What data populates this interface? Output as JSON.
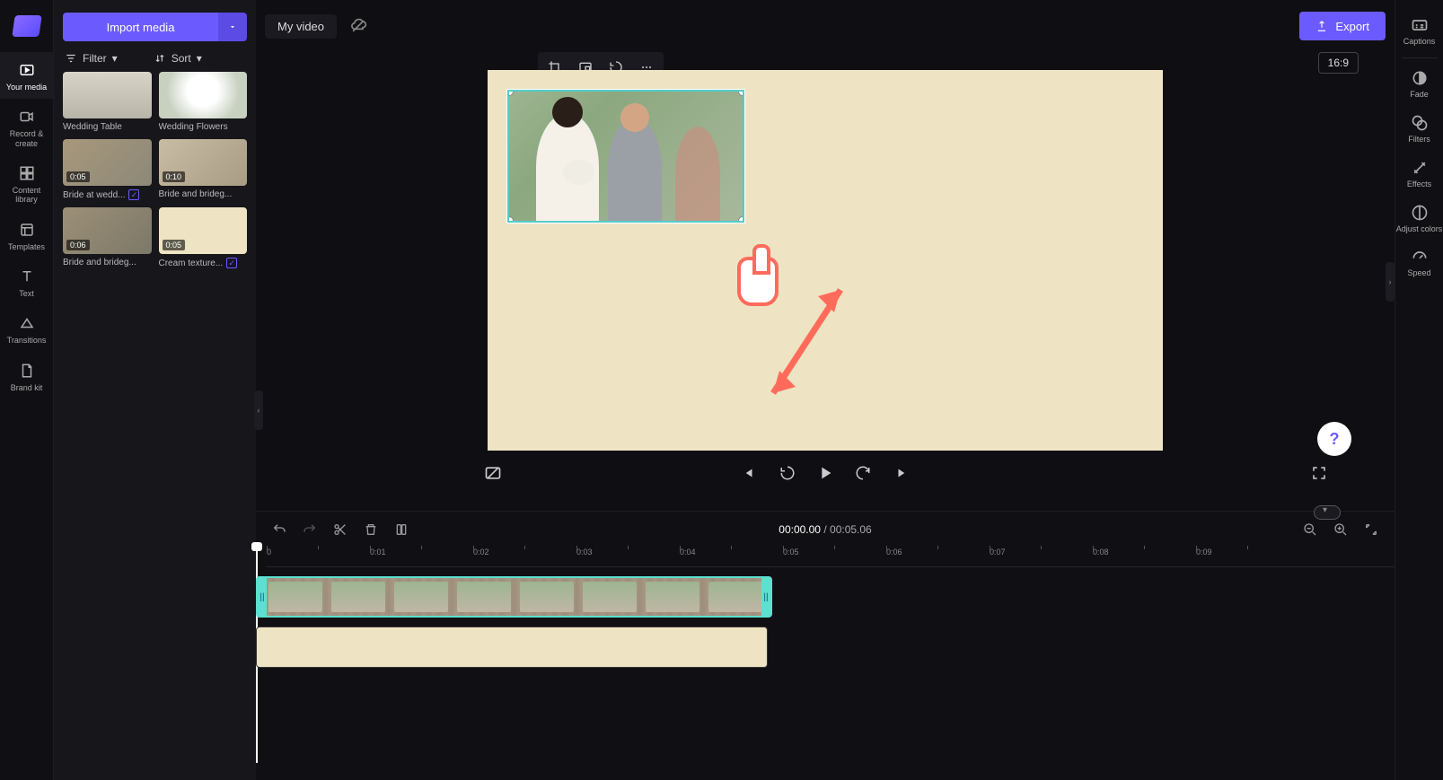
{
  "colors": {
    "accent": "#6b5bff",
    "teal": "#5ce0cf",
    "red_hint": "#ff6b5b",
    "canvas_bg": "#eee4c4"
  },
  "left_nav": {
    "items": [
      {
        "label": "Your media"
      },
      {
        "label": "Record & create"
      },
      {
        "label": "Content library"
      },
      {
        "label": "Templates"
      },
      {
        "label": "Text"
      },
      {
        "label": "Transitions"
      },
      {
        "label": "Brand kit"
      }
    ]
  },
  "media_panel": {
    "import_label": "Import media",
    "filter_label": "Filter",
    "sort_label": "Sort",
    "items": [
      {
        "name": "Wedding Table",
        "duration": ""
      },
      {
        "name": "Wedding Flowers",
        "duration": ""
      },
      {
        "name": "Bride at wedd...",
        "duration": "0:05",
        "used": true
      },
      {
        "name": "Bride and brideg...",
        "duration": "0:10"
      },
      {
        "name": "Bride and brideg...",
        "duration": "0:06"
      },
      {
        "name": "Cream texture...",
        "duration": "0:05",
        "used": true
      }
    ]
  },
  "header": {
    "title": "My video",
    "export_label": "Export"
  },
  "canvas": {
    "aspect_label": "16:9"
  },
  "timeline": {
    "current_time": "00:00.00",
    "separator": "/",
    "total_time": "00:05.06",
    "ruler": [
      "0",
      "0:01",
      "0:02",
      "0:03",
      "0:04",
      "0:05",
      "0:06",
      "0:07",
      "0:08",
      "0:09"
    ]
  },
  "right_panel": {
    "items": [
      {
        "label": "Captions"
      },
      {
        "label": "Fade"
      },
      {
        "label": "Filters"
      },
      {
        "label": "Effects"
      },
      {
        "label": "Adjust colors"
      },
      {
        "label": "Speed"
      }
    ]
  },
  "help": {
    "label": "?"
  }
}
